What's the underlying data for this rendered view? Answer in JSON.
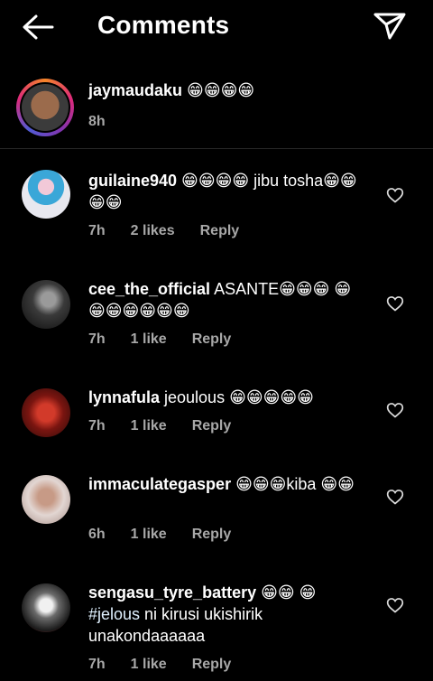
{
  "header": {
    "title": "Comments",
    "back_icon": "back-arrow-icon",
    "send_icon": "send-icon"
  },
  "caption": {
    "username": "jaymaudaku",
    "text": " 😁😁😁😁",
    "time": "8h"
  },
  "comments": [
    {
      "username": "guilaine940",
      "text": " 😁😁😁😁 jibu tosha😁😁😁😁",
      "time": "7h",
      "likes": "2 likes",
      "reply": "Reply"
    },
    {
      "username": "cee_the_official",
      "text": " ASANTE😁😁😁 😁😁😁😁😁😁😁",
      "time": "7h",
      "likes": "1 like",
      "reply": "Reply"
    },
    {
      "username": "lynnafula",
      "text": " jeoulous 😁😁😁😁😁",
      "time": "7h",
      "likes": "1 like",
      "reply": "Reply"
    },
    {
      "username": "immaculategasper",
      "text": " 😁😁😁kiba 😁😁",
      "time": "6h",
      "likes": "1 like",
      "reply": "Reply"
    },
    {
      "username": "sengasu_tyre_battery",
      "text_pre": " 😁😁 😁 ",
      "hashtag": "#jelous",
      "text_post": " ni kirusi ukishirik unakondaaaaaa",
      "time": "7h",
      "likes": "1 like",
      "reply": "Reply"
    }
  ],
  "colors": {
    "background": "#000000",
    "text": "#ffffff",
    "secondary": "#a8a8a8",
    "divider": "#262626",
    "hashtag": "#e0f1ff"
  }
}
